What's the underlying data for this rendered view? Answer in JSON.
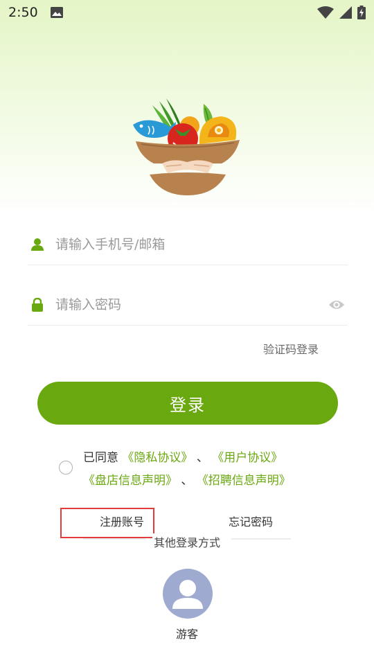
{
  "status_bar": {
    "time": "2:50",
    "icons": [
      "gallery-icon",
      "wifi-icon",
      "signal-icon",
      "battery-charging-icon"
    ]
  },
  "logo": {
    "icon": "vegetable-basket-logo"
  },
  "login_form": {
    "account_placeholder": "请输入手机号/邮箱",
    "password_placeholder": "请输入密码",
    "account_icon": "user-icon",
    "password_icon": "lock-icon",
    "visibility_icon": "eye-icon",
    "sms_login_label": "验证码登录",
    "login_button_label": "登录"
  },
  "agreement": {
    "checked": false,
    "prefix": "已同意",
    "privacy_link": "《隐私协议》",
    "separator1": "、",
    "user_link": "《用户协议》",
    "store_link": "《盘店信息声明》",
    "separator2": "、",
    "hiring_link": "《招聘信息声明》"
  },
  "links": {
    "register": "注册账号",
    "forgot_password": "忘记密码"
  },
  "other_login": {
    "title": "其他登录方式",
    "guest_label": "游客",
    "guest_icon": "guest-avatar-icon"
  },
  "colors": {
    "accent": "#6aa80f",
    "highlight_box": "#e23b3b",
    "avatar_bg": "#9eaad0"
  }
}
